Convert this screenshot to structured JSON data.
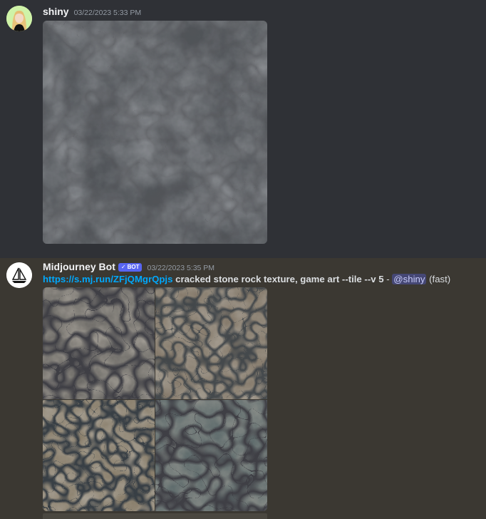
{
  "messages": [
    {
      "author": "shiny",
      "timestamp": "03/22/2023 5:33 PM",
      "attachment": {
        "kind": "image",
        "description_icon": "stone-texture"
      }
    },
    {
      "author": "Midjourney Bot",
      "badge": "BOT",
      "badge_check": "✓",
      "timestamp": "03/22/2023 5:35 PM",
      "link": "https://s.mj.run/ZFjQMgrQpjs",
      "prompt": "cracked stone rock texture, game art --tile --v 5",
      "separator": " - ",
      "mention": "@shiny",
      "speed": "(fast)",
      "attachment": {
        "kind": "image-grid",
        "tiles": 4
      }
    }
  ],
  "colors": {
    "background_dark": "#2f3136",
    "background_highlight": "#3b3832",
    "link": "#00a8fc",
    "bot_badge": "#5865f2",
    "username": "#f2f3f5",
    "timestamp": "#949ba4"
  }
}
